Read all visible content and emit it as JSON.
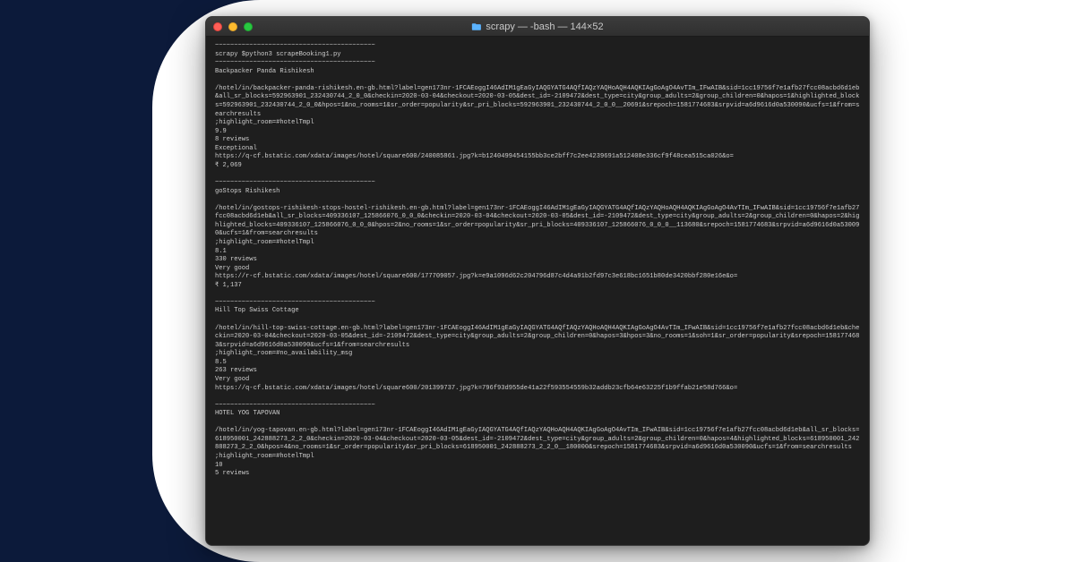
{
  "window": {
    "title": "scrapy — -bash — 144×52"
  },
  "terminal": {
    "sep": "~~~~~~~~~~~~~~~~~~~~~~~~~~~~~~~~~~~~~~~~~~",
    "prompt": "scrapy $python3 scrapeBooking1.py",
    "entries": [
      {
        "name": "Backpacker Panda Rishikesh",
        "url": "/hotel/in/backpacker-panda-rishikesh.en-gb.html?label=gen173nr-1FCAEoggI46AdIM1gEaGyIAQGYATG4AQfIAQzYAQHoAQH4AQKIAgGoAgO4AvTIm_IFwAIB&sid=1cc19756f7e1afb27fcc08acbd6d1eb&all_sr_blocks=592963901_232430744_2_0_0&checkin=2020-03-04&checkout=2020-03-05&dest_id=-2109472&dest_type=city&group_adults=2&group_children=0&hapos=1&highlighted_blocks=592963901_232430744_2_0_0&hpos=1&no_rooms=1&sr_order=popularity&sr_pri_blocks=592963901_232430744_2_0_0__20691&srepoch=1581774683&srpvid=a6d9616d0a530090&ucfs=1&from=searchresults",
        "highlight": ";highlight_room=#hotelTmpl",
        "score": "9.9",
        "reviews": "8 reviews",
        "rating": "Exceptional",
        "img": "https://q-cf.bstatic.com/xdata/images/hotel/square600/240085861.jpg?k=b1240499454155bb3ce2bff7c2ee4239691a512408e336cf9f48cea515ca026&o=",
        "price": "₹ 2,069"
      },
      {
        "name": "goStops Rishikesh",
        "url": "/hotel/in/gostops-rishikesh-stops-hostel-rishikesh.en-gb.html?label=gen173nr-1FCAEoggI46AdIM1gEaGyIAQGYATG4AQfIAQzYAQHoAQH4AQKIAgGoAgO4AvTIm_IFwAIB&sid=1cc19756f7e1afb27fcc08acbd6d1eb&all_sr_blocks=409336107_125866076_0_0_0&checkin=2020-03-04&checkout=2020-03-05&dest_id=-2109472&dest_type=city&group_adults=2&group_children=0&hapos=2&highlighted_blocks=409336107_125866076_0_0_0&hpos=2&no_rooms=1&sr_order=popularity&sr_pri_blocks=409336107_125866076_0_0_0__113680&srepoch=1581774683&srpvid=a6d9616d0a530090&ucfs=1&from=searchresults",
        "highlight": ";highlight_room=#hotelTmpl",
        "score": "8.1",
        "reviews": "330 reviews",
        "rating": "Very good",
        "img": "https://r-cf.bstatic.com/xdata/images/hotel/square600/177709057.jpg?k=e9a1096d62c204796d87c4d4a91b2fd97c3e618bc1651b80de3420bbf280e16e&o=",
        "price": "₹ 1,137"
      },
      {
        "name": "Hill Top Swiss Cottage",
        "url": "/hotel/in/hill-top-swiss-cottage.en-gb.html?label=gen173nr-1FCAEoggI46AdIM1gEaGyIAQGYATG4AQfIAQzYAQHoAQH4AQKIAgGoAgO4AvTIm_IFwAIB&sid=1cc19756f7e1afb27fcc08acbd6d1eb&checkin=2020-03-04&checkout=2020-03-05&dest_id=-2109472&dest_type=city&group_adults=2&group_children=0&hapos=3&hpos=3&no_rooms=1&soh=1&sr_order=popularity&srepoch=1581774683&srpvid=a6d9616d0a530090&ucfs=1&from=searchresults",
        "highlight": ";highlight_room=#no_availability_msg",
        "score": "8.5",
        "reviews": "263 reviews",
        "rating": "Very good",
        "img": "https://q-cf.bstatic.com/xdata/images/hotel/square600/201399737.jpg?k=796f93d955de41a22f593554559b32addb23cfb64e63225f1b9ffab21e58d766&o=",
        "price": ""
      },
      {
        "name": "HOTEL YOG TAPOVAN",
        "url": "/hotel/in/yog-tapovan.en-gb.html?label=gen173nr-1FCAEoggI46AdIM1gEaGyIAQGYATG4AQfIAQzYAQHoAQH4AQKIAgGoAgO4AvTIm_IFwAIB&sid=1cc19756f7e1afb27fcc08acbd6d1eb&all_sr_blocks=618950001_242888273_2_2_0&checkin=2020-03-04&checkout=2020-03-05&dest_id=-2109472&dest_type=city&group_adults=2&group_children=0&hapos=4&highlighted_blocks=618950001_242888273_2_2_0&hpos=4&no_rooms=1&sr_order=popularity&sr_pri_blocks=618950001_242888273_2_2_0__180000&srepoch=1581774683&srpvid=a6d9616d0a530090&ucfs=1&from=searchresults",
        "highlight": ";highlight_room=#hotelTmpl",
        "score": "10",
        "reviews": "5 reviews",
        "rating": "",
        "img": "",
        "price": ""
      }
    ]
  }
}
